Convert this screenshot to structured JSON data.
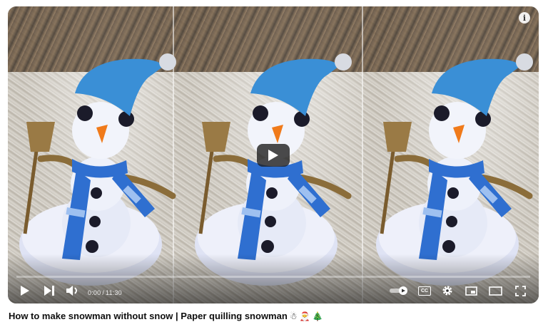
{
  "video": {
    "title": "How to make snowman without snow | Paper quilling snowman",
    "title_emojis": [
      "☃",
      "🎅",
      "🎄"
    ],
    "current_time": "0:00",
    "duration": "11:30",
    "progress_fraction": 0.0,
    "info_label": "i"
  },
  "controls": {
    "left": [
      "play-icon",
      "next-icon",
      "volume-icon"
    ],
    "right": [
      "autoplay-toggle-icon",
      "subtitles-icon",
      "settings-icon",
      "miniplayer-icon",
      "theater-mode-icon",
      "fullscreen-icon"
    ],
    "subtitles_label": "CC"
  },
  "colors": {
    "hat": "#3a8fd6",
    "scarf": "#2f6fd0",
    "snow": "#e8ecf6",
    "nose": "#f07a1a",
    "button": "#1b1b2a",
    "broom": "#8b6d3a"
  }
}
